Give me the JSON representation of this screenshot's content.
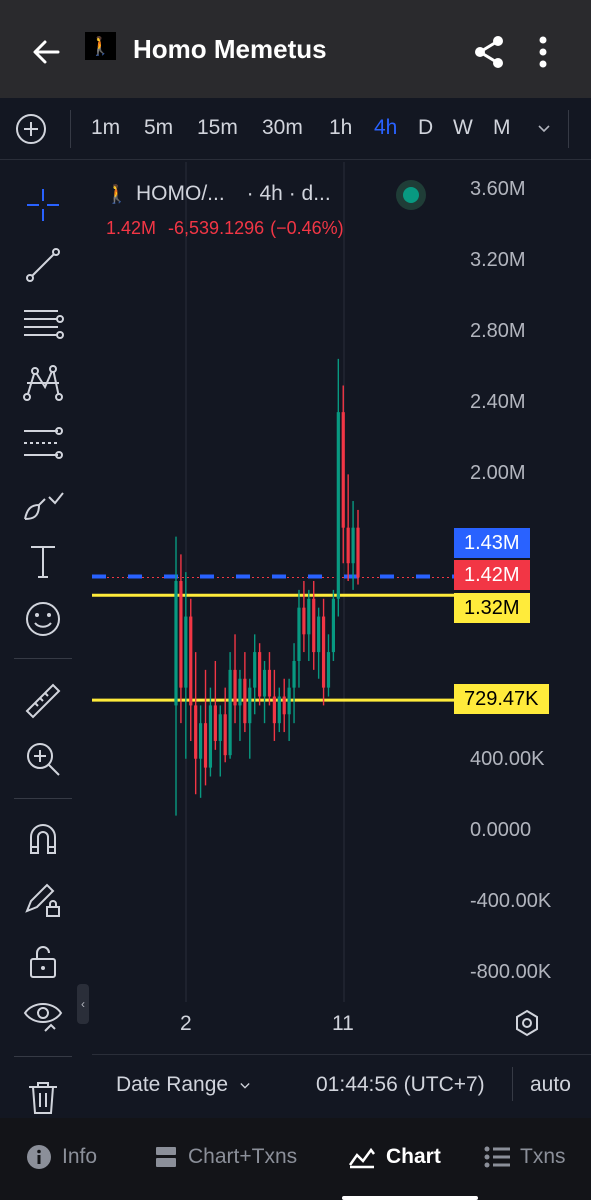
{
  "header": {
    "title": "Homo Memetus",
    "logo_glyph": "🚶"
  },
  "intervals": [
    {
      "label": "1m",
      "active": false
    },
    {
      "label": "5m",
      "active": false
    },
    {
      "label": "15m",
      "active": false
    },
    {
      "label": "30m",
      "active": false
    },
    {
      "label": "1h",
      "active": false
    },
    {
      "label": "4h",
      "active": true
    },
    {
      "label": "D",
      "active": false
    },
    {
      "label": "W",
      "active": false
    },
    {
      "label": "M",
      "active": false
    }
  ],
  "chart": {
    "symbol": "HOMO/...",
    "meta": "· 4h · d...",
    "last_value": "1.42M",
    "change": "-6,539.1296",
    "change_pct": "(−0.46%)",
    "price_labels": [
      "3.60M",
      "3.20M",
      "2.80M",
      "2.40M",
      "2.00M",
      "400.00K",
      "0.0000",
      "-400.00K",
      "-800.00K"
    ],
    "tags": {
      "blue": "1.43M",
      "red": "1.42M",
      "yellow_1": "1.32M",
      "yellow_2": "729.47K"
    },
    "dates": [
      "2",
      "11"
    ],
    "colors": {
      "up": "#089981",
      "down": "#f23645",
      "level": "#ffeb3b",
      "accent": "#2962ff"
    }
  },
  "range_bar": {
    "date_range": "Date Range",
    "clock": "01:44:56 (UTC+7)",
    "scale": "auto"
  },
  "nav": {
    "info": "Info",
    "chart_txns": "Chart+Txns",
    "chart": "Chart",
    "txns": "Txns"
  },
  "chart_data": {
    "type": "candlestick",
    "title": "",
    "xlabel": "",
    "ylabel": "",
    "ylim": [
      -800000,
      3600000
    ],
    "x_ticks": [
      "2",
      "11"
    ],
    "levels": [
      1320000,
      729470
    ],
    "last_price": 1420000,
    "y_ticks": [
      3600000,
      3200000,
      2800000,
      2400000,
      2000000,
      400000,
      0,
      -400000,
      -800000
    ],
    "candles": [
      {
        "o": 700000,
        "h": 1650000,
        "l": 80000,
        "c": 1400000
      },
      {
        "o": 1400000,
        "h": 1550000,
        "l": 600000,
        "c": 800000
      },
      {
        "o": 800000,
        "h": 1450000,
        "l": 400000,
        "c": 1200000
      },
      {
        "o": 1200000,
        "h": 1300000,
        "l": 500000,
        "c": 700000
      },
      {
        "o": 700000,
        "h": 1000000,
        "l": 200000,
        "c": 400000
      },
      {
        "o": 400000,
        "h": 700000,
        "l": 180000,
        "c": 600000
      },
      {
        "o": 600000,
        "h": 900000,
        "l": 250000,
        "c": 350000
      },
      {
        "o": 350000,
        "h": 800000,
        "l": 300000,
        "c": 700000
      },
      {
        "o": 700000,
        "h": 950000,
        "l": 450000,
        "c": 500000
      },
      {
        "o": 500000,
        "h": 700000,
        "l": 300000,
        "c": 650000
      },
      {
        "o": 650000,
        "h": 800000,
        "l": 380000,
        "c": 420000
      },
      {
        "o": 420000,
        "h": 1000000,
        "l": 400000,
        "c": 900000
      },
      {
        "o": 900000,
        "h": 1100000,
        "l": 600000,
        "c": 700000
      },
      {
        "o": 700000,
        "h": 900000,
        "l": 500000,
        "c": 850000
      },
      {
        "o": 850000,
        "h": 1000000,
        "l": 550000,
        "c": 600000
      },
      {
        "o": 600000,
        "h": 850000,
        "l": 400000,
        "c": 800000
      },
      {
        "o": 800000,
        "h": 1100000,
        "l": 650000,
        "c": 1000000
      },
      {
        "o": 1000000,
        "h": 1050000,
        "l": 700000,
        "c": 750000
      },
      {
        "o": 750000,
        "h": 950000,
        "l": 600000,
        "c": 900000
      },
      {
        "o": 900000,
        "h": 1000000,
        "l": 700000,
        "c": 750000
      },
      {
        "o": 750000,
        "h": 900000,
        "l": 500000,
        "c": 600000
      },
      {
        "o": 600000,
        "h": 800000,
        "l": 550000,
        "c": 750000
      },
      {
        "o": 750000,
        "h": 850000,
        "l": 550000,
        "c": 650000
      },
      {
        "o": 650000,
        "h": 850000,
        "l": 500000,
        "c": 800000
      },
      {
        "o": 800000,
        "h": 1050000,
        "l": 600000,
        "c": 950000
      },
      {
        "o": 950000,
        "h": 1350000,
        "l": 800000,
        "c": 1250000
      },
      {
        "o": 1250000,
        "h": 1400000,
        "l": 1000000,
        "c": 1100000
      },
      {
        "o": 1100000,
        "h": 1350000,
        "l": 950000,
        "c": 1300000
      },
      {
        "o": 1300000,
        "h": 1400000,
        "l": 900000,
        "c": 1000000
      },
      {
        "o": 1000000,
        "h": 1250000,
        "l": 850000,
        "c": 1200000
      },
      {
        "o": 1200000,
        "h": 1300000,
        "l": 700000,
        "c": 800000
      },
      {
        "o": 800000,
        "h": 1100000,
        "l": 750000,
        "c": 1000000
      },
      {
        "o": 1000000,
        "h": 1350000,
        "l": 950000,
        "c": 1300000
      },
      {
        "o": 1300000,
        "h": 2650000,
        "l": 1200000,
        "c": 2350000
      },
      {
        "o": 2350000,
        "h": 2500000,
        "l": 1500000,
        "c": 1700000
      },
      {
        "o": 1700000,
        "h": 2000000,
        "l": 1400000,
        "c": 1500000
      },
      {
        "o": 1500000,
        "h": 1850000,
        "l": 1350000,
        "c": 1700000
      },
      {
        "o": 1700000,
        "h": 1800000,
        "l": 1380000,
        "c": 1420000
      }
    ]
  }
}
